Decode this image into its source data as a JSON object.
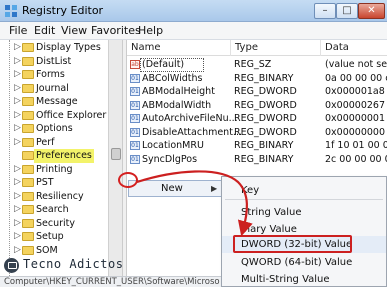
{
  "window": {
    "title": "Registry Editor",
    "controls": {
      "minimize": "–",
      "maximize": "□",
      "close": "✕"
    }
  },
  "menubar": {
    "items": [
      "File",
      "Edit",
      "View",
      "Favorites",
      "Help"
    ]
  },
  "tree": {
    "items": [
      {
        "label": "Display Types",
        "expandable": true
      },
      {
        "label": "DistList",
        "expandable": true
      },
      {
        "label": "Forms",
        "expandable": true
      },
      {
        "label": "Journal",
        "expandable": true
      },
      {
        "label": "Message",
        "expandable": true
      },
      {
        "label": "Office Explorer",
        "expandable": true
      },
      {
        "label": "Options",
        "expandable": true
      },
      {
        "label": "Perf",
        "expandable": true
      },
      {
        "label": "Preferences",
        "expandable": false,
        "selected": true
      },
      {
        "label": "Printing",
        "expandable": true
      },
      {
        "label": "PST",
        "expandable": true
      },
      {
        "label": "Resiliency",
        "expandable": true
      },
      {
        "label": "Search",
        "expandable": true
      },
      {
        "label": "Security",
        "expandable": true
      },
      {
        "label": "Setup",
        "expandable": true
      },
      {
        "label": "SOM",
        "expandable": true
      }
    ]
  },
  "list": {
    "headers": {
      "name": "Name",
      "type": "Type",
      "data": "Data"
    },
    "rows": [
      {
        "icon": "ab",
        "name": "(Default)",
        "type": "REG_SZ",
        "data": "(value not set)"
      },
      {
        "icon": "bin",
        "name": "ABColWidths",
        "type": "REG_BINARY",
        "data": "0a 00 00 00 c2"
      },
      {
        "icon": "bin",
        "name": "ABModalHeight",
        "type": "REG_DWORD",
        "data": "0x000001a8 (42"
      },
      {
        "icon": "bin",
        "name": "ABModalWidth",
        "type": "REG_DWORD",
        "data": "0x00000267 (61"
      },
      {
        "icon": "bin",
        "name": "AutoArchiveFileNu...",
        "type": "REG_DWORD",
        "data": "0x00000001 (1)"
      },
      {
        "icon": "bin",
        "name": "DisableAttachment...",
        "type": "REG_DWORD",
        "data": "0x00000000 (0)"
      },
      {
        "icon": "bin",
        "name": "LocationMRU",
        "type": "REG_BINARY",
        "data": "1f 10 01 00 00 0"
      },
      {
        "icon": "bin",
        "name": "SyncDlgPos",
        "type": "REG_BINARY",
        "data": "2c 00 00 00 00"
      }
    ]
  },
  "context_menu": {
    "new_label": "New",
    "arrow": "▶"
  },
  "submenu": {
    "items": [
      {
        "label": "Key"
      },
      {
        "label": "String Value"
      },
      {
        "label": "inary Value"
      },
      {
        "label": "DWORD (32-bit) Value",
        "highlighted": true
      },
      {
        "label": "QWORD (64-bit) Value"
      },
      {
        "label": "Multi-String Value"
      }
    ]
  },
  "statusbar": {
    "path": "Computer\\HKEY_CURRENT_USER\\Software\\Microso"
  },
  "watermark": {
    "text": "Tecno Adictos"
  },
  "colors": {
    "selection_highlight": "#f3f36a",
    "annotation_red": "#cc2020",
    "folder_yellow": "#f4d35e"
  },
  "icons": {
    "app": "registry-icon",
    "folder": "folder-icon",
    "string_value": "ab-string-icon",
    "binary_value": "binary-value-icon",
    "watermark": "monitor-icon"
  }
}
